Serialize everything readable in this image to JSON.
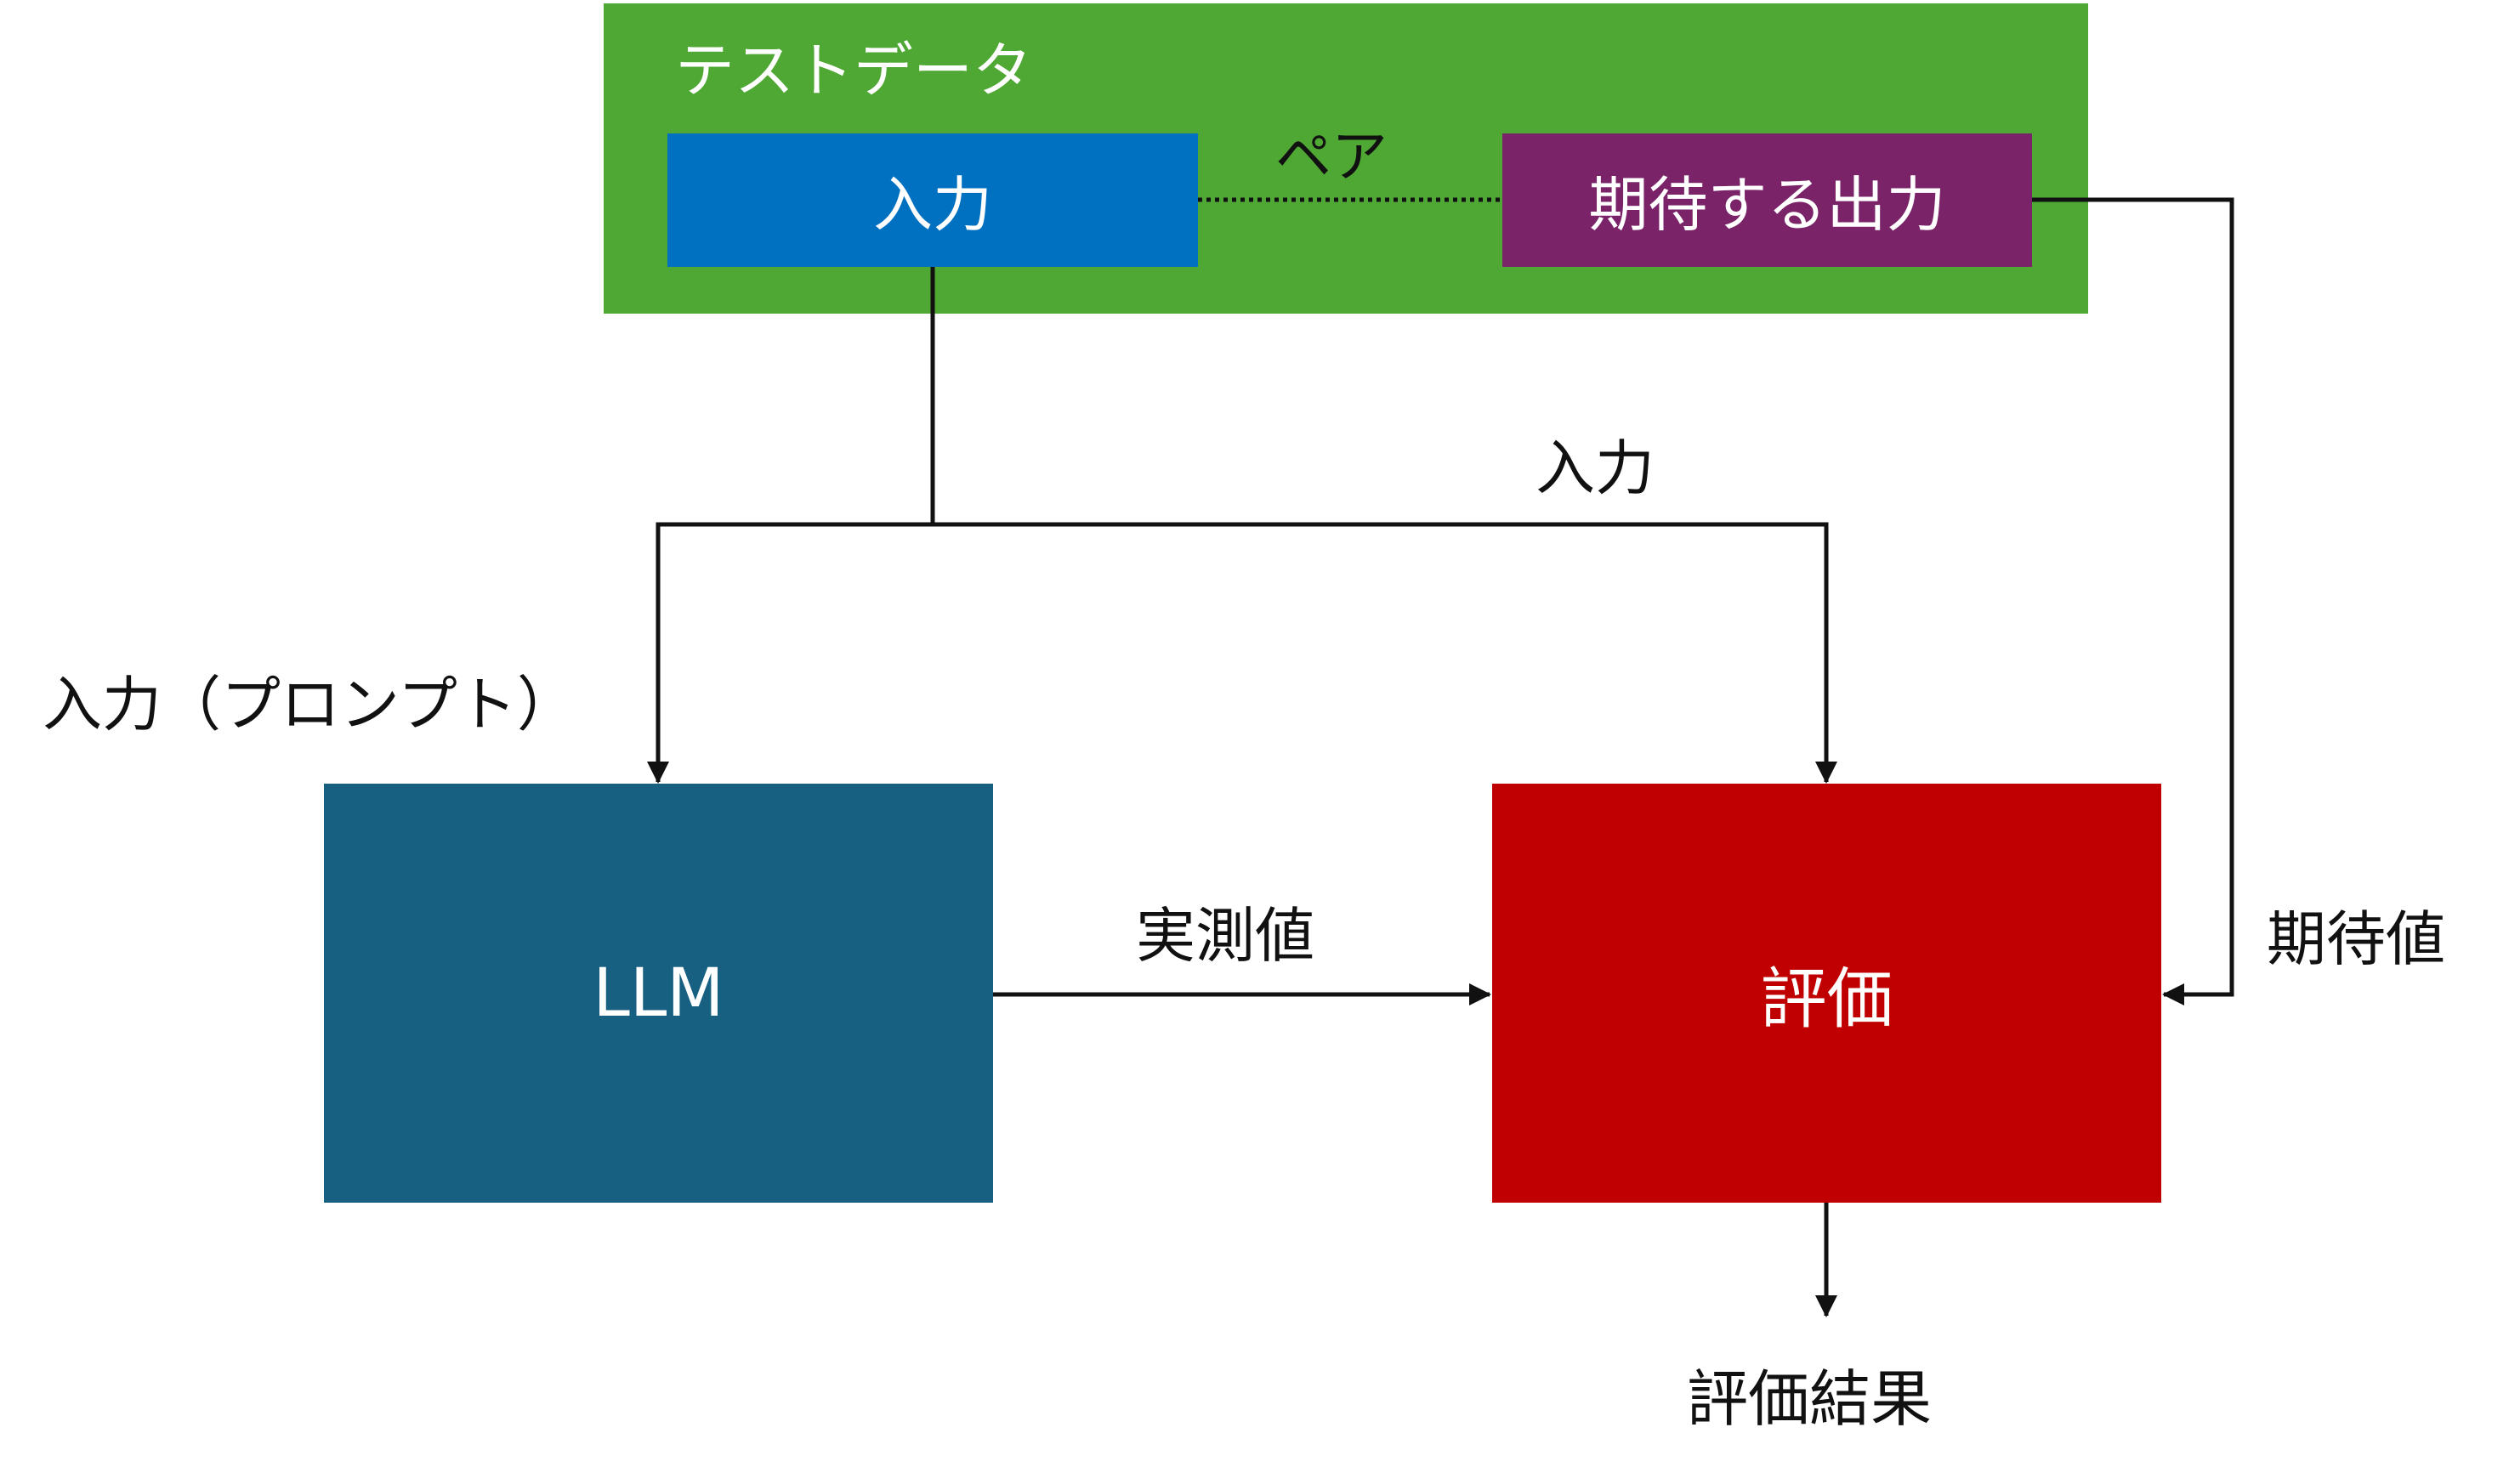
{
  "test_data": {
    "title": "テストデータ",
    "input_label": "入力",
    "pair_label": "ペア",
    "expected_label": "期待する出力"
  },
  "edges": {
    "input_label": "入力",
    "prompt_label": "入力（プロンプト）",
    "measured_label": "実測値",
    "expected_value_label": "期待値"
  },
  "nodes": {
    "llm": "LLM",
    "evaluation": "評価",
    "result": "評価結果"
  },
  "colors": {
    "test_data_group": "#4fa834",
    "input_box": "#0070c0",
    "expected_box": "#7b2369",
    "llm_box": "#186081",
    "evaluation_box": "#c00000",
    "connector": "#111111"
  }
}
